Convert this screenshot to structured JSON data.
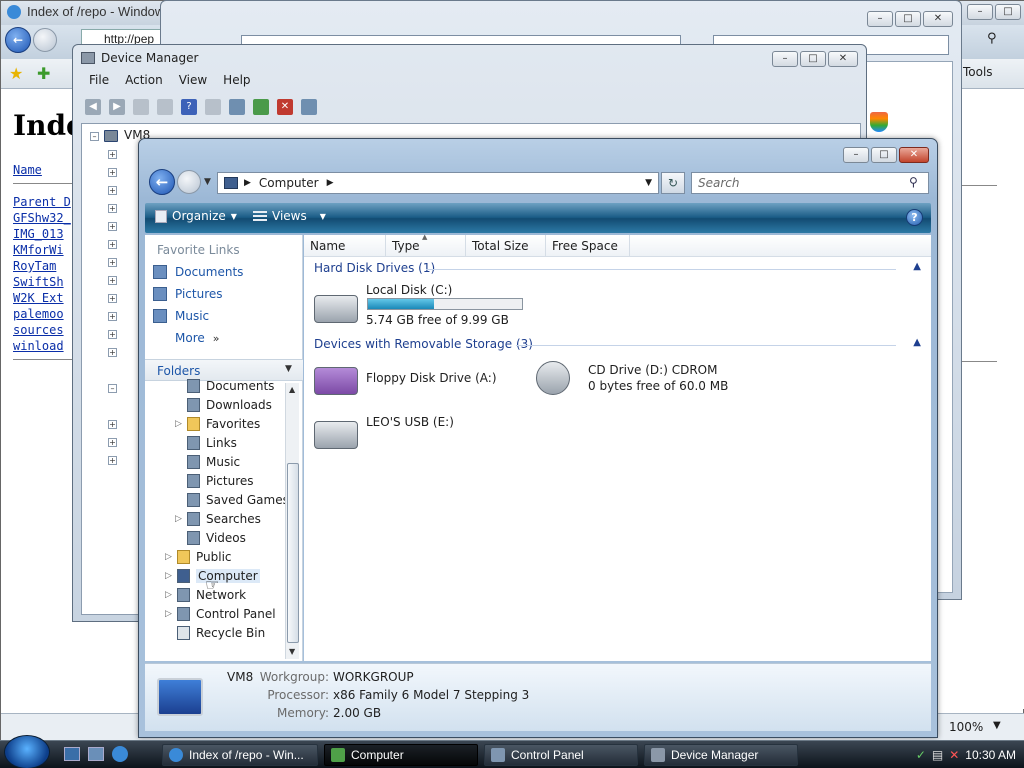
{
  "ie": {
    "title": "Index of /repo - Windows",
    "url": "http://pep",
    "tools_label": "Tools",
    "page_heading": "Inde",
    "links": [
      "Name",
      "Parent D",
      "GFShw32_",
      "IMG_013",
      "KMforWi",
      "RoyTam",
      "SwiftSh",
      "W2K Ext",
      "palemoo",
      "sources",
      "winload"
    ],
    "zoom": "100%"
  },
  "control_panel": {
    "title": "Control Panel"
  },
  "device_manager": {
    "title": "Device Manager",
    "menu": [
      "File",
      "Action",
      "View",
      "Help"
    ],
    "root": "VM8"
  },
  "explorer": {
    "breadcrumb": [
      "Computer"
    ],
    "search_placeholder": "Search",
    "toolbar": {
      "organize": "Organize",
      "views": "Views"
    },
    "favorite_links": {
      "title": "Favorite Links",
      "items": [
        "Documents",
        "Pictures",
        "Music"
      ],
      "more": "More"
    },
    "folders": {
      "title": "Folders",
      "items": [
        "Documents",
        "Downloads",
        "Favorites",
        "Links",
        "Music",
        "Pictures",
        "Saved Games",
        "Searches",
        "Videos",
        "Public",
        "Computer",
        "Network",
        "Control Panel",
        "Recycle Bin"
      ]
    },
    "columns": [
      "Name",
      "Type",
      "Total Size",
      "Free Space"
    ],
    "groups": {
      "hdd": {
        "title": "Hard Disk Drives (1)",
        "drives": [
          {
            "name": "Local Disk (C:)",
            "detail": "5.74 GB free of 9.99 GB",
            "used_fraction": 0.43
          }
        ]
      },
      "removable": {
        "title": "Devices with Removable Storage (3)",
        "drives": [
          {
            "name": "Floppy Disk Drive (A:)"
          },
          {
            "name": "CD Drive (D:) CDROM",
            "detail": "0 bytes free of 60.0 MB"
          },
          {
            "name": "LEO'S USB (E:)"
          }
        ]
      }
    },
    "details": {
      "name": "VM8",
      "workgroup_label": "Workgroup:",
      "workgroup": "WORKGROUP",
      "processor_label": "Processor:",
      "processor": "x86 Family 6 Model 7 Stepping 3",
      "memory_label": "Memory:",
      "memory": "2.00 GB"
    }
  },
  "taskbar": {
    "buttons": [
      "Index of /repo - Win...",
      "Computer",
      "Control Panel",
      "Device Manager"
    ],
    "clock": "10:30 AM"
  },
  "colors": {
    "accent": "#1a5c86",
    "link": "#0a2ea8",
    "group_header": "#1e3f8f"
  }
}
